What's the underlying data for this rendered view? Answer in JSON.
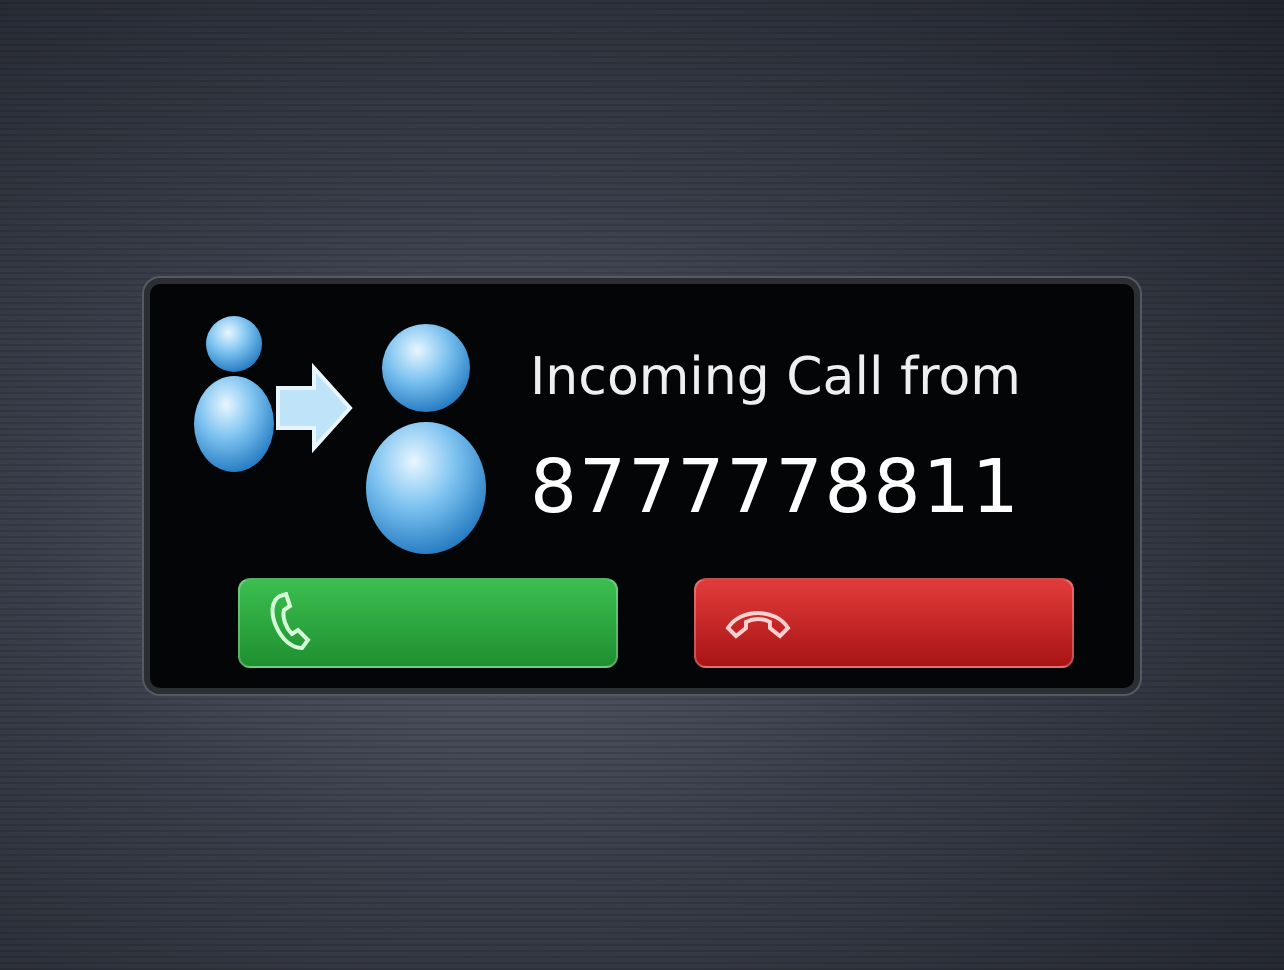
{
  "dialog": {
    "title": "Incoming Call from",
    "caller": "8777778811",
    "buttons": [
      {
        "kind": "answer"
      },
      {
        "kind": "decline"
      }
    ]
  }
}
